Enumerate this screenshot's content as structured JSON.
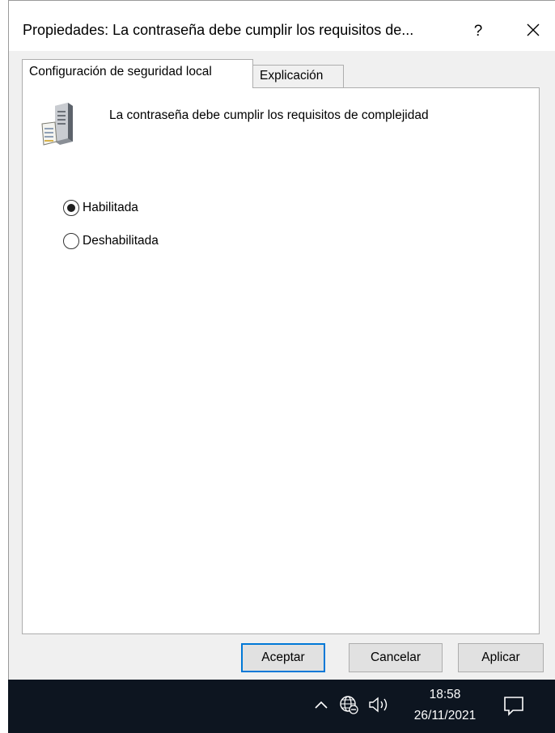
{
  "window": {
    "title": "Propiedades: La contraseña debe cumplir los requisitos de...",
    "help_label": "?"
  },
  "tabs": [
    {
      "label": "Configuración de seguridad local",
      "active": true
    },
    {
      "label": "Explicación",
      "active": false
    }
  ],
  "policy": {
    "icon": "server-policy-icon",
    "title": "La contraseña debe cumplir los requisitos de complejidad"
  },
  "options": [
    {
      "label": "Habilitada",
      "checked": true
    },
    {
      "label": "Deshabilitada",
      "checked": false
    }
  ],
  "buttons": {
    "ok": "Aceptar",
    "cancel": "Cancelar",
    "apply": "Aplicar"
  },
  "taskbar": {
    "time": "18:58",
    "date": "26/11/2021",
    "icons": [
      "chevron-up-icon",
      "network-icon",
      "volume-icon",
      "notification-icon"
    ]
  }
}
